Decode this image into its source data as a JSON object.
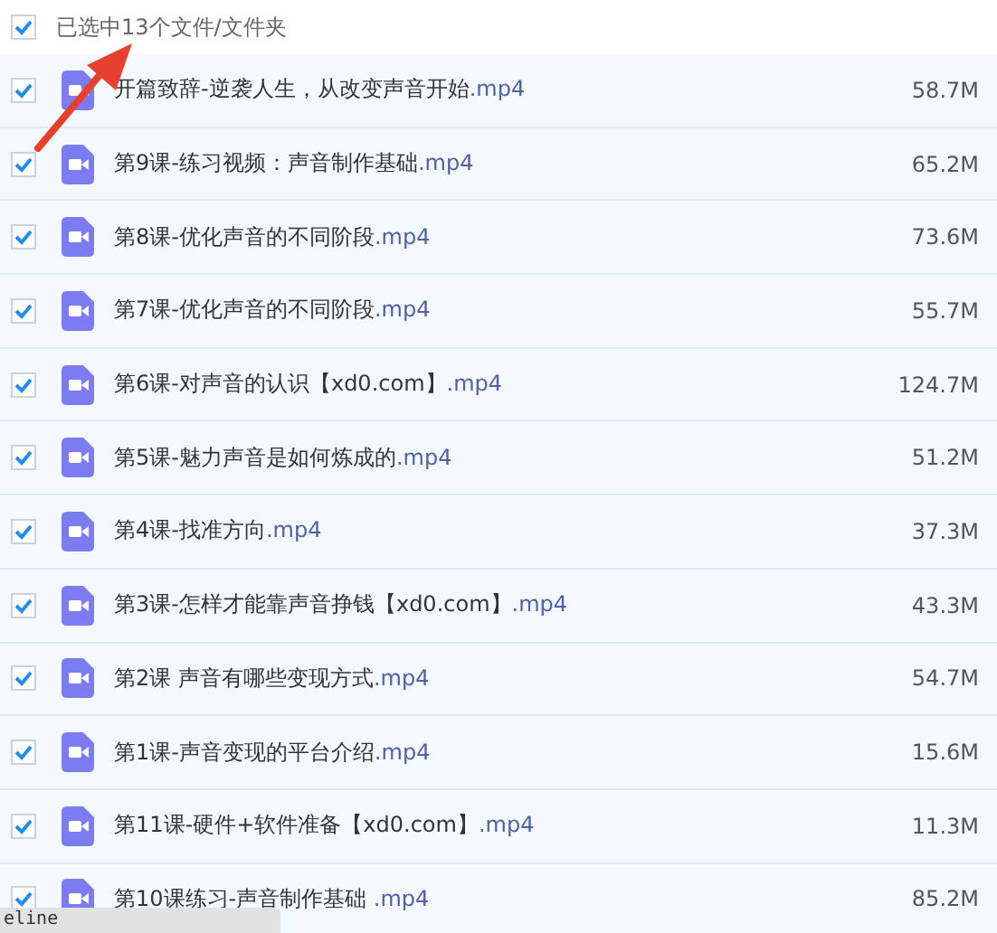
{
  "header": {
    "checked": true,
    "label": "已选中13个文件/文件夹"
  },
  "files": [
    {
      "name": "开篇致辞-逆袭人生，从改变声音开始",
      "ext": ".mp4",
      "size": "58.7M",
      "checked": true
    },
    {
      "name": "第9课-练习视频：声音制作基础",
      "ext": ".mp4",
      "size": "65.2M",
      "checked": true
    },
    {
      "name": "第8课-优化声音的不同阶段",
      "ext": ".mp4",
      "size": "73.6M",
      "checked": true
    },
    {
      "name": "第7课-优化声音的不同阶段",
      "ext": ".mp4",
      "size": "55.7M",
      "checked": true
    },
    {
      "name": "第6课-对声音的认识【xd0.com】",
      "ext": ".mp4",
      "size": "124.7M",
      "checked": true
    },
    {
      "name": "第5课-魅力声音是如何炼成的",
      "ext": ".mp4",
      "size": "51.2M",
      "checked": true
    },
    {
      "name": "第4课-找准方向",
      "ext": ".mp4",
      "size": "37.3M",
      "checked": true
    },
    {
      "name": "第3课-怎样才能靠声音挣钱【xd0.com】",
      "ext": ".mp4",
      "size": "43.3M",
      "checked": true
    },
    {
      "name": "第2课 声音有哪些变现方式",
      "ext": ".mp4",
      "size": "54.7M",
      "checked": true
    },
    {
      "name": "第1课-声音变现的平台介绍",
      "ext": ".mp4",
      "size": "15.6M",
      "checked": true
    },
    {
      "name": "第11课-硬件+软件准备【xd0.com】",
      "ext": ".mp4",
      "size": "11.3M",
      "checked": true
    },
    {
      "name": "第10课练习-声音制作基础 ",
      "ext": ".mp4",
      "size": "85.2M",
      "checked": true
    }
  ],
  "status_tip": "eline"
}
